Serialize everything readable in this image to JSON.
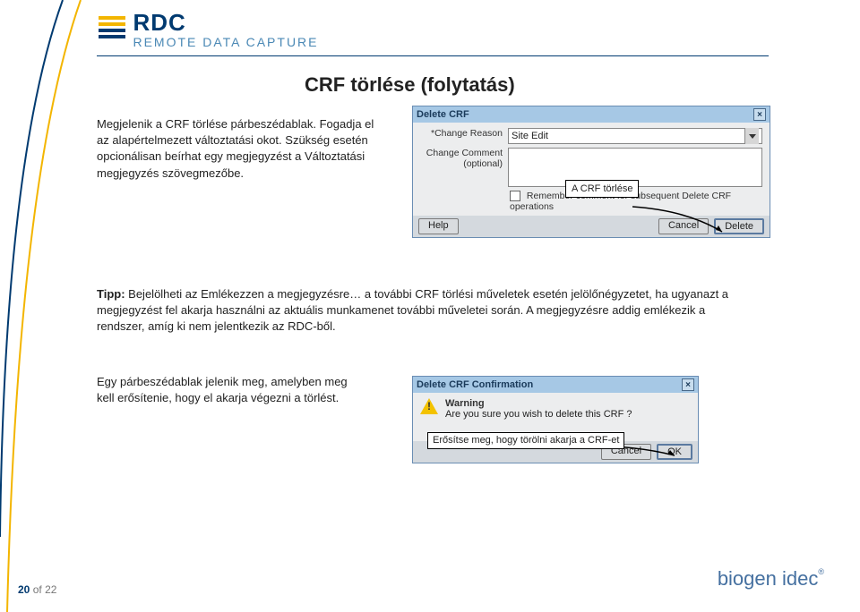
{
  "logo": {
    "main": "RDC",
    "sub": "REMOTE DATA CAPTURE"
  },
  "title": "CRF törlése (folytatás)",
  "paragraph1": "Megjelenik a CRF törlése párbeszédablak. Fogadja el az alapértelmezett változtatási okot. Szükség esetén opcionálisan beírhat egy megjegyzést a Változtatási megjegyzés szövegmezőbe.",
  "dialog1": {
    "title": "Delete CRF",
    "label_reason": "*Change Reason",
    "reason_value": "Site Edit",
    "label_comment": "Change Comment (optional)",
    "annotation": "A CRF törlése",
    "remember": "Remember comment for subsequent Delete CRF operations",
    "btn_help": "Help",
    "btn_cancel": "Cancel",
    "btn_delete": "Delete"
  },
  "tip": {
    "label": "Tipp:",
    "text": "Bejelölheti az Emlékezzen a megjegyzésre… a további CRF törlési műveletek esetén jelölőnégyzetet, ha ugyanazt a megjegyzést fel akarja használni az aktuális munkamenet további műveletei során. A megjegyzésre addig emlékezik a rendszer, amíg ki nem jelentkezik az RDC-ből."
  },
  "paragraph2": "Egy párbeszédablak jelenik meg, amelyben meg kell erősítenie, hogy el akarja végezni a törlést.",
  "dialog2": {
    "title": "Delete CRF Confirmation",
    "warn_head": "Warning",
    "warn_body": "Are you sure you wish to delete this CRF ?",
    "annotation": "Erősítse meg, hogy törölni akarja a CRF-et",
    "btn_cancel": "Cancel",
    "btn_ok": "OK"
  },
  "pager": {
    "cur": "20",
    "of": "of",
    "total": "22"
  },
  "brand": "biogen idec"
}
